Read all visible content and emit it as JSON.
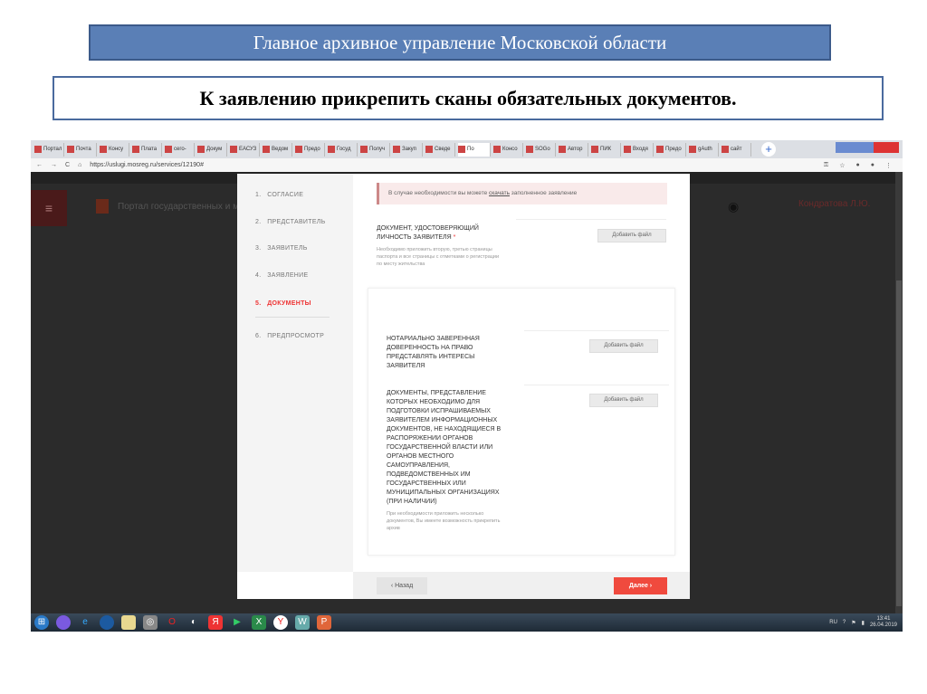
{
  "slide": {
    "title": "Главное архивное управление Московской области",
    "subtitle": "К заявлению прикрепить сканы обязательных документов."
  },
  "browser": {
    "tabs": [
      "Портал",
      "Почта",
      "Консу",
      "Плата",
      "сего-",
      "Докум",
      "ЕАСУЗ",
      "Ведом",
      "Предо",
      "Госуд",
      "Получ",
      "Закуп",
      "Сведе",
      "По",
      "Консо",
      "SOGo",
      "Автор",
      "ПИК",
      "Входя",
      "Предо",
      "gAuth",
      "сайт"
    ],
    "url": "https://uslugi.mosreg.ru/services/12190#"
  },
  "background": {
    "portal": "Портал государственных и му",
    "user": "Кондратова Л.Ю."
  },
  "nav": [
    {
      "num": "1.",
      "label": "СОГЛАСИЕ"
    },
    {
      "num": "2.",
      "label": "ПРЕДСТАВИТЕЛЬ"
    },
    {
      "num": "3.",
      "label": "ЗАЯВИТЕЛЬ"
    },
    {
      "num": "4.",
      "label": "ЗАЯВЛЕНИЕ"
    },
    {
      "num": "5.",
      "label": "ДОКУМЕНТЫ"
    },
    {
      "num": "6.",
      "label": "ПРЕДПРОСМОТР"
    }
  ],
  "alert": {
    "before": "В случае необходимости вы можете ",
    "link": "скачать",
    "after": " заполненное заявление"
  },
  "docs": [
    {
      "title": "Документ, удостоверяющий личность заявителя",
      "required": "*",
      "hint": "Необходимо приложить вторую, третью страницы паспорта и все страницы с отметками о регистрации по месту жительства",
      "button": "Добавить файл"
    },
    {
      "title": "Нотариально заверенная доверенность на право представлять интересы заявителя",
      "button": "Добавить файл"
    },
    {
      "title": "Документы, представление которых необходимо для подготовки испрашиваемых заявителем информационных документов, не находящиеся в распоряжении органов государственной власти или органов местного самоуправления, подведомственных им государственных или муниципальных организациях (при наличии)",
      "hint": "При необходимости приложить несколько документов, Вы имеете возможность прикрепить архив",
      "button": "Добавить файл"
    }
  ],
  "footer": {
    "back": "‹ Назад",
    "next": "Далее ›"
  },
  "taskbar": {
    "lang": "RU",
    "time": "13:41",
    "date": "26.04.2019"
  }
}
